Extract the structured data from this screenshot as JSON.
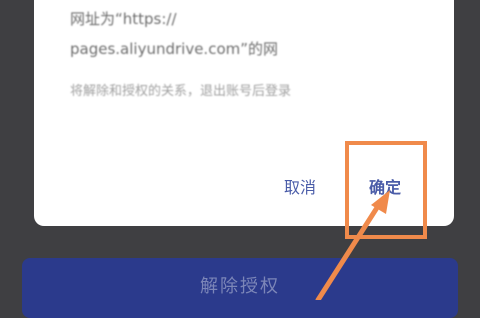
{
  "dialog": {
    "message_lines": [
      "网址为“https://",
      "pages.aliyundrive.com”的网",
      "将解除和授权的关系，退出账号后登录"
    ],
    "cancel_label": "取消",
    "confirm_label": "确定"
  },
  "page": {
    "revoke_button_label": "解除授权"
  },
  "colors": {
    "overlay_background": "#3f3f42",
    "dialog_background": "#ffffff",
    "dialog_action_text": "#4a5ca8",
    "highlight": "#f08a4b",
    "revoke_button": "#2b3a8c"
  }
}
